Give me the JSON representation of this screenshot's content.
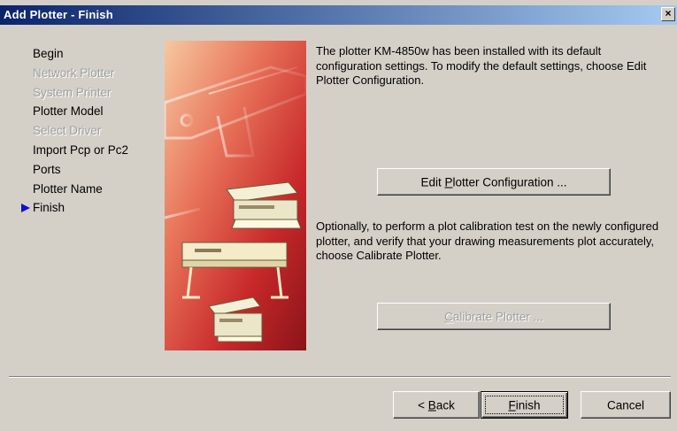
{
  "window": {
    "title": "Add Plotter - Finish",
    "close_label": "×"
  },
  "steps": [
    {
      "label": "Begin",
      "enabled": true,
      "current": false
    },
    {
      "label": "Network Plotter",
      "enabled": false,
      "current": false
    },
    {
      "label": "System Printer",
      "enabled": false,
      "current": false
    },
    {
      "label": "Plotter Model",
      "enabled": true,
      "current": false
    },
    {
      "label": "Select Driver",
      "enabled": false,
      "current": false
    },
    {
      "label": "Import Pcp or Pc2",
      "enabled": true,
      "current": false
    },
    {
      "label": "Ports",
      "enabled": true,
      "current": false
    },
    {
      "label": "Plotter Name",
      "enabled": true,
      "current": false
    },
    {
      "label": "Finish",
      "enabled": true,
      "current": true
    }
  ],
  "main": {
    "intro_text": "The plotter KM-4850w has been installed with its default configuration settings.  To modify the default settings, choose Edit Plotter Configuration.",
    "edit_button": {
      "pre": "Edit ",
      "accel": "P",
      "post": "lotter Configuration ..."
    },
    "calibrate_text": "Optionally, to perform a plot calibration test on the newly configured plotter, and verify that your drawing measurements plot accurately, choose Calibrate Plotter.",
    "calibrate_button": {
      "pre": "",
      "accel": "C",
      "post": "alibrate Plotter ..."
    }
  },
  "footer": {
    "back_button": {
      "pre": "< ",
      "accel": "B",
      "post": "ack"
    },
    "finish_button": {
      "pre": "",
      "accel": "F",
      "post": "inish"
    },
    "cancel_button": {
      "label": "Cancel"
    }
  },
  "colors": {
    "title_start": "#0a246a",
    "title_end": "#a6caf0",
    "face": "#d4d0c8",
    "step_arrow": "#1010d0",
    "art_red": "#c8282a"
  }
}
